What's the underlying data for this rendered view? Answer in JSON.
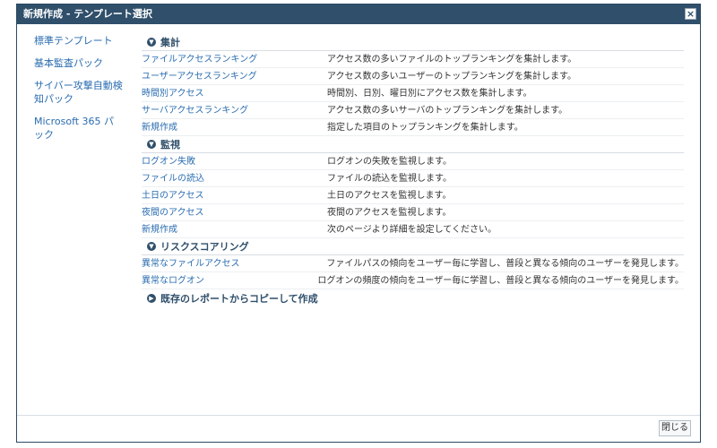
{
  "dialog": {
    "title": "新規作成 - テンプレート選択",
    "close_icon": "×"
  },
  "sidebar": {
    "items": [
      {
        "label": "標準テンプレート"
      },
      {
        "label": "基本監査パック"
      },
      {
        "label": "サイバー攻撃自動検知パック"
      },
      {
        "label": "Microsoft 365 パック"
      }
    ]
  },
  "sections": {
    "aggregate": {
      "title": "集計",
      "icon": "chevron-down",
      "rows": [
        {
          "name": "ファイルアクセスランキング",
          "desc": "アクセス数の多いファイルのトップランキングを集計します。"
        },
        {
          "name": "ユーザーアクセスランキング",
          "desc": "アクセス数の多いユーザーのトップランキングを集計します。"
        },
        {
          "name": "時間別アクセス",
          "desc": "時間別、日別、曜日別にアクセス数を集計します。"
        },
        {
          "name": "サーバアクセスランキング",
          "desc": "アクセス数の多いサーバのトップランキングを集計します。"
        },
        {
          "name": "新規作成",
          "desc": "指定した項目のトップランキングを集計します。"
        }
      ]
    },
    "monitor": {
      "title": "監視",
      "icon": "chevron-down",
      "rows": [
        {
          "name": "ログオン失敗",
          "desc": "ログオンの失敗を監視します。"
        },
        {
          "name": "ファイルの読込",
          "desc": "ファイルの読込を監視します。"
        },
        {
          "name": "土日のアクセス",
          "desc": "土日のアクセスを監視します。"
        },
        {
          "name": "夜間のアクセス",
          "desc": "夜間のアクセスを監視します。"
        },
        {
          "name": "新規作成",
          "desc": "次のページより詳細を設定してください。"
        }
      ]
    },
    "risk": {
      "title": "リスクスコアリング",
      "icon": "chevron-down",
      "rows": [
        {
          "name": "異常なファイルアクセス",
          "desc": "ファイルパスの傾向をユーザー毎に学習し、普段と異なる傾向のユーザーを発見します。"
        },
        {
          "name": "異常なログオン",
          "desc": "ログオンの頻度の傾向をユーザー毎に学習し、普段と異なる傾向のユーザーを発見します。"
        }
      ]
    },
    "copy": {
      "title": "既存のレポートからコピーして作成",
      "icon": "chevron-right"
    }
  },
  "footer": {
    "close_label": "閉じる"
  },
  "colors": {
    "titlebar": "#2f4f6b",
    "link": "#2a6cb0",
    "text": "#333333"
  }
}
